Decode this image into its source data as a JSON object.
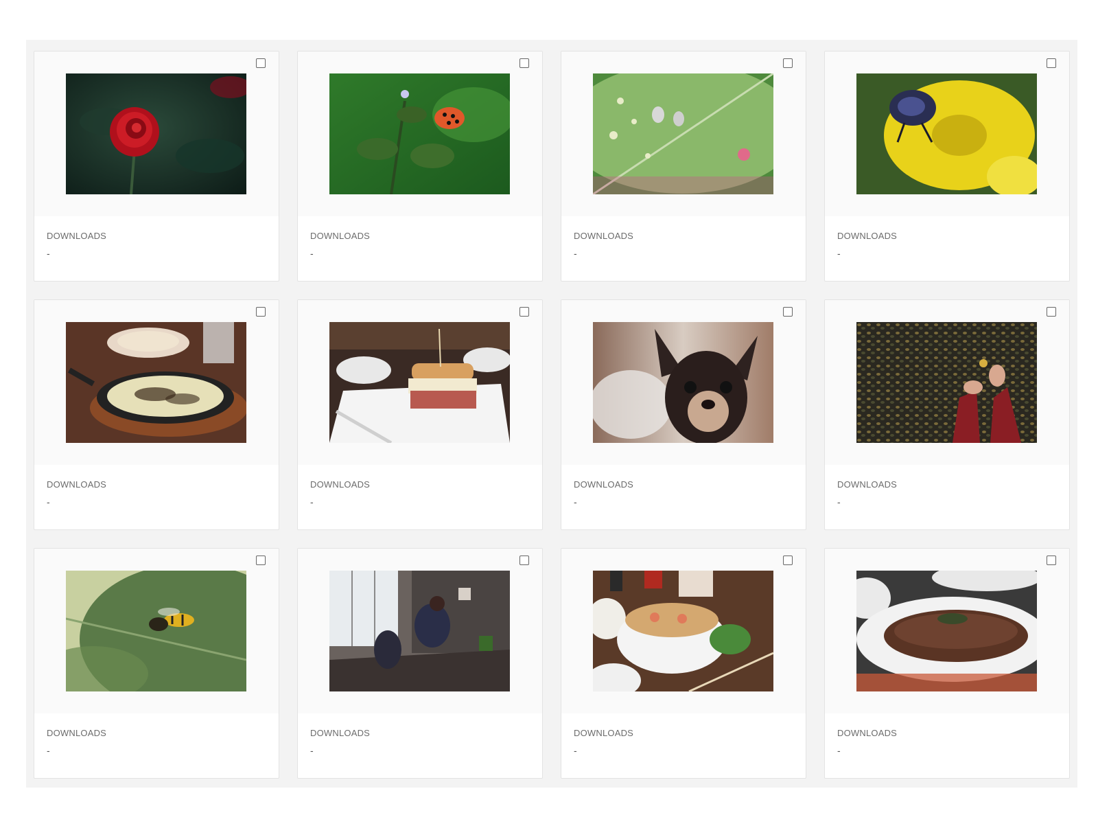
{
  "cards": [
    {
      "photo": "red-rose-photo",
      "label": "DOWNLOADS",
      "value": "-"
    },
    {
      "photo": "ladybug-photo",
      "label": "DOWNLOADS",
      "value": "-"
    },
    {
      "photo": "bugs-on-leaf-photo",
      "label": "DOWNLOADS",
      "value": "-"
    },
    {
      "photo": "beetle-on-yellow-flower-photo",
      "label": "DOWNLOADS",
      "value": "-"
    },
    {
      "photo": "skillet-dish-photo",
      "label": "DOWNLOADS",
      "value": "-"
    },
    {
      "photo": "sandwich-photo",
      "label": "DOWNLOADS",
      "value": "-"
    },
    {
      "photo": "chihuahua-photo",
      "label": "DOWNLOADS",
      "value": "-"
    },
    {
      "photo": "hands-in-leaves-photo",
      "label": "DOWNLOADS",
      "value": "-"
    },
    {
      "photo": "wasp-on-leaf-photo",
      "label": "DOWNLOADS",
      "value": "-"
    },
    {
      "photo": "woman-at-desk-photo",
      "label": "DOWNLOADS",
      "value": "-"
    },
    {
      "photo": "pho-soup-photo",
      "label": "DOWNLOADS",
      "value": "-"
    },
    {
      "photo": "steak-plate-photo",
      "label": "DOWNLOADS",
      "value": "-"
    }
  ]
}
